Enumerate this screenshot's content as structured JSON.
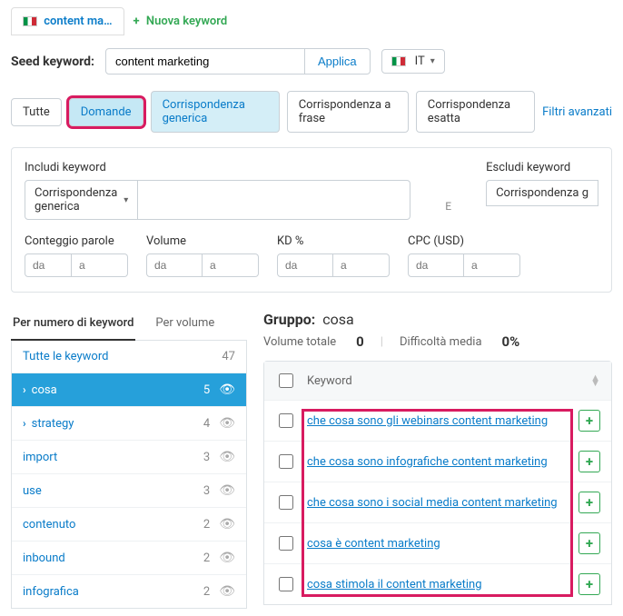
{
  "tabs": {
    "main_tab": "content ma…",
    "new_keyword": "Nuova keyword"
  },
  "seed": {
    "label": "Seed keyword:",
    "value": "content marketing",
    "apply": "Applica",
    "locale": "IT"
  },
  "filter_tabs": {
    "all": "Tutte",
    "questions": "Domande",
    "broad": "Corrispondenza generica",
    "phrase": "Corrispondenza a frase",
    "exact": "Corrispondenza esatta",
    "advanced": "Filtri avanzati"
  },
  "include": {
    "label": "Includi keyword",
    "match": "Corrispondenza generica",
    "sep": "E"
  },
  "exclude": {
    "label": "Escludi keyword",
    "match": "Corrispondenza g"
  },
  "ranges": {
    "wordcount": "Conteggio parole",
    "volume": "Volume",
    "kd": "KD %",
    "cpc": "CPC (USD)",
    "from": "da",
    "to": "a"
  },
  "view_tabs": {
    "by_kw": "Per numero di keyword",
    "by_vol": "Per volume"
  },
  "kw_groups": {
    "all": {
      "label": "Tutte le keyword",
      "count": "47"
    },
    "items": [
      {
        "label": "cosa",
        "count": "5",
        "expandable": true,
        "selected": true
      },
      {
        "label": "strategy",
        "count": "4",
        "expandable": true
      },
      {
        "label": "import",
        "count": "3"
      },
      {
        "label": "use",
        "count": "3"
      },
      {
        "label": "contenuto",
        "count": "2"
      },
      {
        "label": "inbound",
        "count": "2"
      },
      {
        "label": "infografica",
        "count": "2"
      }
    ]
  },
  "group": {
    "title_prefix": "Gruppo:",
    "title_value": "cosa",
    "total_volume_label": "Volume totale",
    "total_volume": "0",
    "avg_diff_label": "Difficoltà media",
    "avg_diff": "0%"
  },
  "table": {
    "col_keyword": "Keyword",
    "rows": [
      {
        "kw": "che cosa sono gli webinars content marketing"
      },
      {
        "kw": "che cosa sono infografiche content marketing"
      },
      {
        "kw": "che cosa sono i social media content marketing"
      },
      {
        "kw": "cosa è content marketing"
      },
      {
        "kw": "cosa stimola il content marketing"
      }
    ]
  }
}
